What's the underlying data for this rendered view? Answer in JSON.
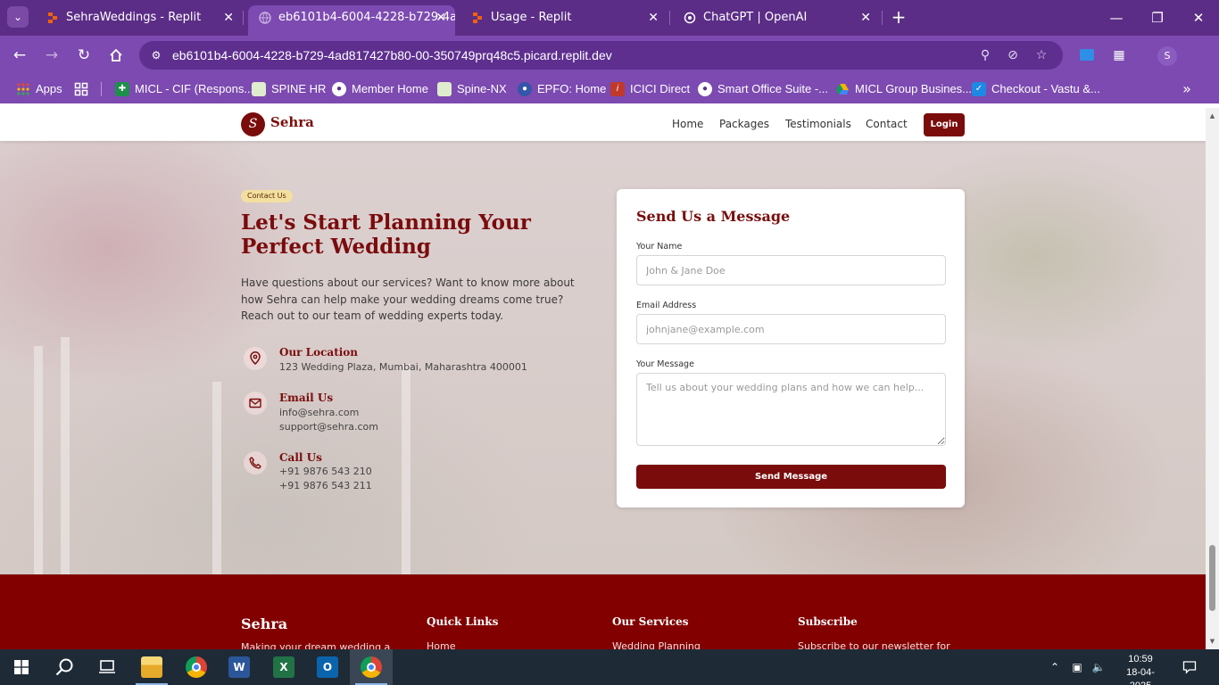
{
  "browser": {
    "tabs": [
      {
        "title": "SehraWeddings - Replit",
        "favicon": "replit-icon",
        "active": false
      },
      {
        "title": "eb6101b4-6004-4228-b729-4ad",
        "favicon": "globe-icon",
        "active": true
      },
      {
        "title": "Usage - Replit",
        "favicon": "replit-icon",
        "active": false
      },
      {
        "title": "ChatGPT | OpenAI",
        "favicon": "openai-icon",
        "active": false
      }
    ],
    "url": "eb6101b4-6004-4228-b729-4ad817427b80-00-350749prq48c5.picard.replit.dev",
    "profile_initial": "S",
    "bookmarks": [
      {
        "label": "Apps",
        "icon": "apps-grid-icon",
        "color": "#e24a3b"
      },
      {
        "label": "",
        "icon": "tab-groups-icon",
        "color": "#7c4ab0"
      },
      {
        "label": "MICL - CIF (Respons...",
        "icon": "micl-icon",
        "color": "#1d8f4a"
      },
      {
        "label": "SPINE HR",
        "icon": "spine-icon",
        "color": "#6aa84f"
      },
      {
        "label": "Member Home",
        "icon": "globe-icon",
        "color": "#5e2f8f"
      },
      {
        "label": "Spine-NX",
        "icon": "spine-icon",
        "color": "#6aa84f"
      },
      {
        "label": "EPFO: Home",
        "icon": "epfo-icon",
        "color": "#3355aa"
      },
      {
        "label": "ICICI Direct",
        "icon": "icici-icon",
        "color": "#c0392b"
      },
      {
        "label": "Smart Office Suite -...",
        "icon": "globe-icon",
        "color": "#5e2f8f"
      },
      {
        "label": "MICL Group Busines...",
        "icon": "drive-icon",
        "color": "#2e7d32"
      },
      {
        "label": "Checkout - Vastu &...",
        "icon": "checkbox-icon",
        "color": "#1e88e5"
      }
    ]
  },
  "site": {
    "brand": "Sehra",
    "logo_letter": "S",
    "nav": [
      "Home",
      "Packages",
      "Testimonials",
      "Contact"
    ],
    "login_label": "Login",
    "brand_color": "#7a0c0c"
  },
  "contact": {
    "badge": "Contact Us",
    "title": "Let's Start Planning Your Perfect Wedding",
    "description": "Have questions about our services? Want to know more about how Sehra can help make your wedding dreams come true? Reach out to our team of wedding experts today.",
    "location": {
      "title": "Our Location",
      "lines": [
        "123 Wedding Plaza, Mumbai, Maharashtra 400001"
      ]
    },
    "email": {
      "title": "Email Us",
      "lines": [
        "info@sehra.com",
        "support@sehra.com"
      ]
    },
    "phone": {
      "title": "Call Us",
      "lines": [
        "+91 9876 543 210",
        "+91 9876 543 211"
      ]
    }
  },
  "form": {
    "title": "Send Us a Message",
    "name_label": "Your Name",
    "name_placeholder": "John & Jane Doe",
    "email_label": "Email Address",
    "email_placeholder": "johnjane@example.com",
    "message_label": "Your Message",
    "message_placeholder": "Tell us about your wedding plans and how we can help...",
    "submit_label": "Send Message"
  },
  "footer": {
    "brand": "Sehra",
    "brand_text": "Making your dream wedding a",
    "columns": [
      {
        "heading": "Quick Links",
        "first_item": "Home"
      },
      {
        "heading": "Our Services",
        "first_item": "Wedding Planning"
      },
      {
        "heading": "Subscribe",
        "first_item": "Subscribe to our newsletter for"
      }
    ]
  },
  "taskbar": {
    "apps": [
      {
        "name": "start",
        "icon": "windows-icon"
      },
      {
        "name": "search",
        "icon": "search-icon"
      },
      {
        "name": "task-view",
        "icon": "task-view-icon"
      },
      {
        "name": "file-explorer",
        "icon": "folder-icon"
      },
      {
        "name": "chrome",
        "icon": "chrome-icon"
      },
      {
        "name": "word",
        "icon": "word-icon"
      },
      {
        "name": "excel",
        "icon": "excel-icon"
      },
      {
        "name": "outlook",
        "icon": "outlook-icon"
      },
      {
        "name": "chrome-active",
        "icon": "chrome-icon"
      }
    ],
    "time": "10:59",
    "date": "18-04-2025"
  }
}
